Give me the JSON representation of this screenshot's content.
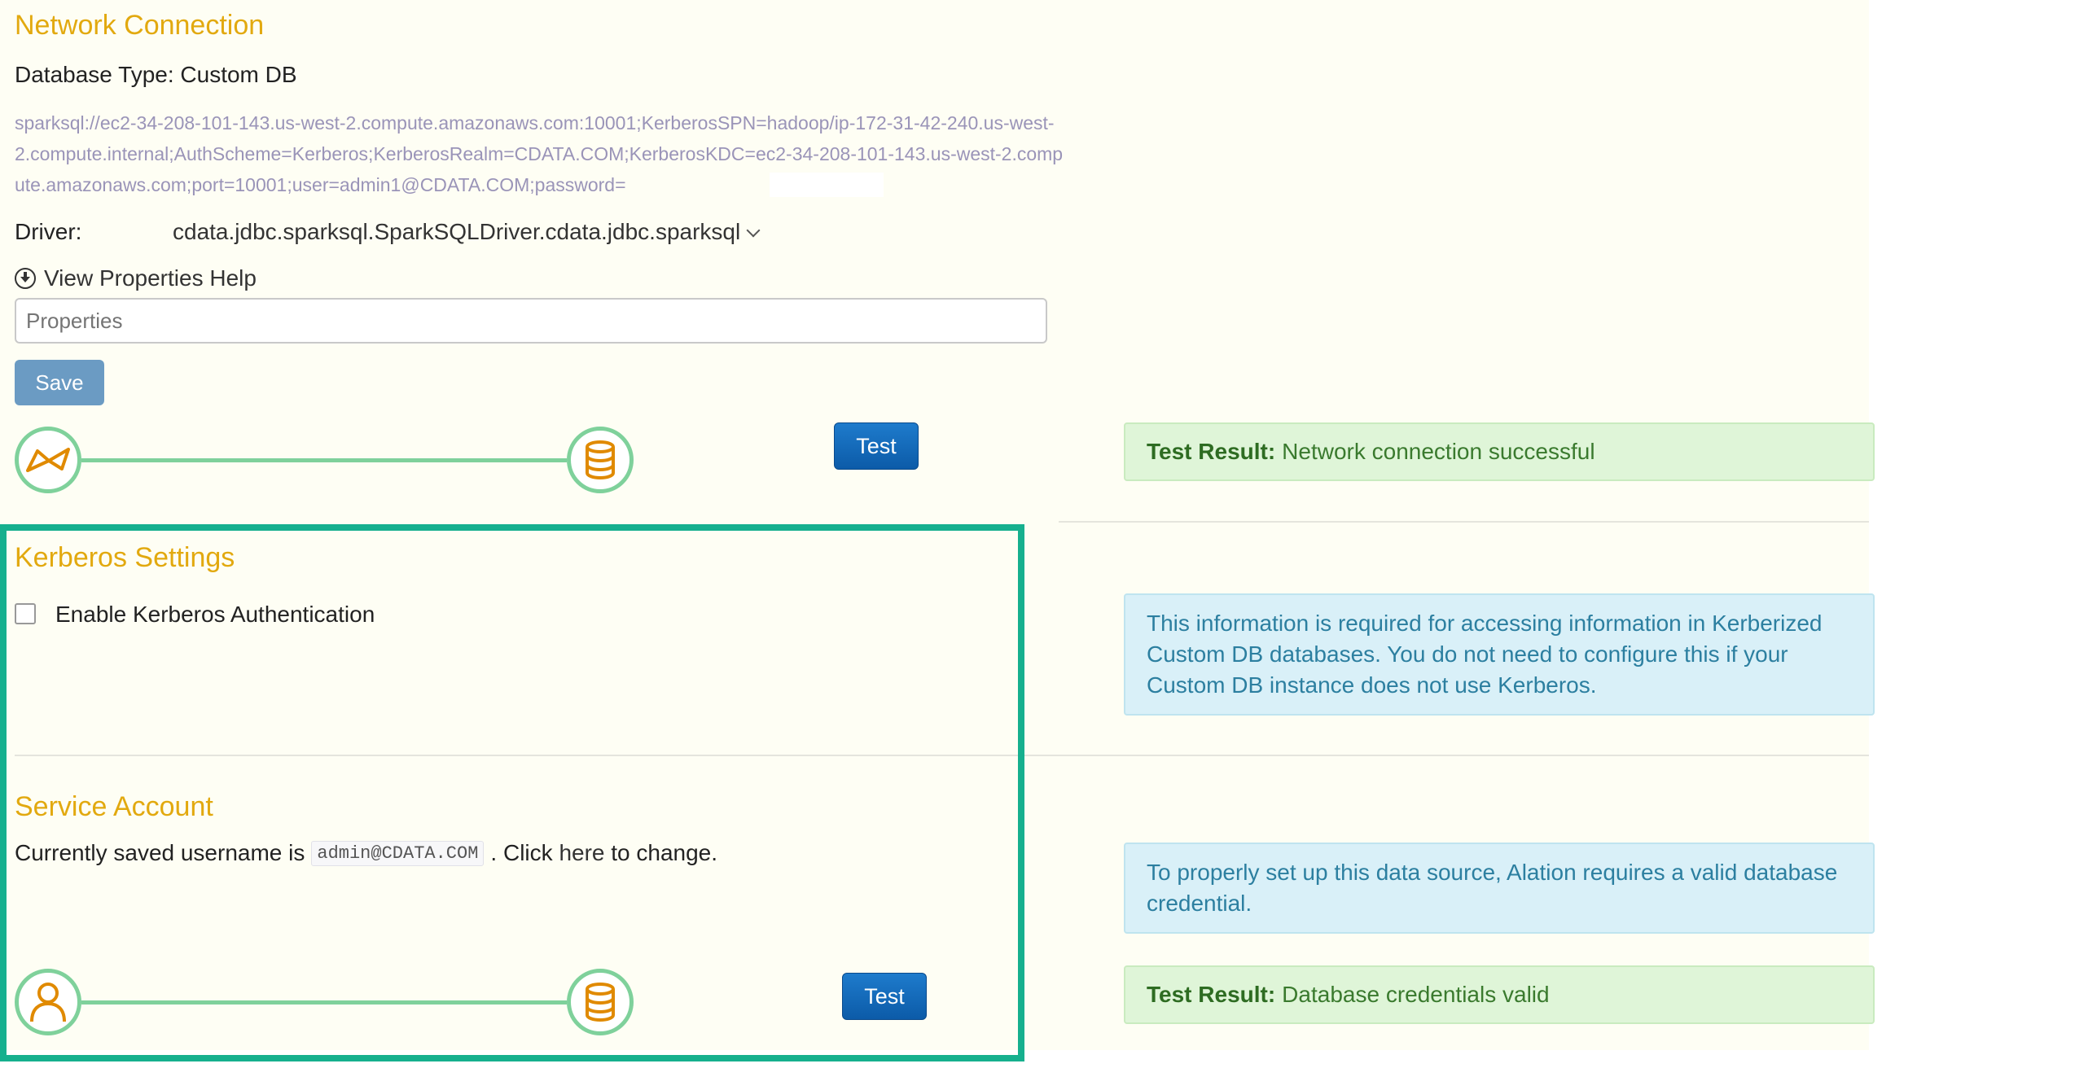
{
  "network": {
    "title": "Network Connection",
    "database_type": "Database Type: Custom DB",
    "connection_string": "sparksql://ec2-34-208-101-143.us-west-2.compute.amazonaws.com:10001;KerberosSPN=hadoop/ip-172-31-42-240.us-west-2.compute.internal;AuthScheme=Kerberos;KerberosRealm=CDATA.COM;KerberosKDC=ec2-34-208-101-143.us-west-2.compute.amazonaws.com;port=10001;user=admin1@CDATA.COM;password=",
    "driver_label": "Driver:",
    "driver_value": "cdata.jdbc.sparksql.SparkSQLDriver.cdata.jdbc.sparksql",
    "view_properties_help": "View Properties Help",
    "properties_placeholder": "Properties",
    "save_label": "Save",
    "test_label": "Test",
    "result_label": "Test Result:",
    "result_text": "Network connection successful"
  },
  "kerberos": {
    "title": "Kerberos Settings",
    "enable_label": "Enable Kerberos Authentication",
    "enabled": false,
    "info_text": "This information is required for accessing information in Kerberized Custom DB databases. You do not need to configure this if your Custom DB instance does not use Kerberos."
  },
  "service_account": {
    "title": "Service Account",
    "saved_prefix": "Currently saved username is",
    "username": "admin@CDATA.COM",
    "click_text": ". Click",
    "here_link": "here",
    "suffix": "to change.",
    "info_text": "To properly set up this data source, Alation requires a valid database credential.",
    "test_label": "Test",
    "result_label": "Test Result:",
    "result_text": "Database credentials valid"
  },
  "colors": {
    "heading": "#e2a90f",
    "connector": "#7fd19b",
    "highlight_box": "#16b08e",
    "test_button": "#1468b8",
    "save_button": "#6b9bc3"
  },
  "icons": {
    "source_node": "spark-bowtie-icon",
    "database_node": "database-icon",
    "user_node": "user-icon"
  }
}
